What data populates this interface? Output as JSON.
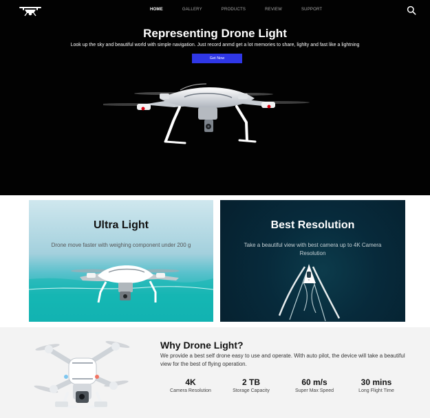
{
  "nav": {
    "logo_icon": "drone-logo-icon",
    "items": [
      {
        "label": "HOME",
        "active": true
      },
      {
        "label": "GALLERY",
        "active": false
      },
      {
        "label": "PRODUCTS",
        "active": false
      },
      {
        "label": "REVIEW",
        "active": false
      },
      {
        "label": "SUPPORT",
        "active": false
      }
    ],
    "search_icon": "search-icon"
  },
  "hero": {
    "title": "Representing Drone Light",
    "subtitle": "Look up the sky and beautiful world with simple navigation. Just record anmd get a lot memories to share, lighlty and fast like a lightning",
    "button_label": "Get Now",
    "button_color": "#2f37e6"
  },
  "cards": [
    {
      "title": "Ultra Light",
      "text": "Drone move faster with weighing component under 200 g",
      "image": "drone-over-sea"
    },
    {
      "title": "Best Resolution",
      "text": "Take a beautiful view with best camera up to 4K Camera Resolution",
      "image": "boat-wake-aerial"
    }
  ],
  "why": {
    "title": "Why Drone Light?",
    "text": "We provide a best self drone easy to use and operate. With auto pilot, the device will take a beautiful view for the best of flying operation.",
    "stats": [
      {
        "value": "4K",
        "label": "Camera Resolution"
      },
      {
        "value": "2 TB",
        "label": "Storage Capacity"
      },
      {
        "value": "60 m/s",
        "label": "Super Max Speed"
      },
      {
        "value": "30 mins",
        "label": "Long Flight Time"
      }
    ]
  }
}
